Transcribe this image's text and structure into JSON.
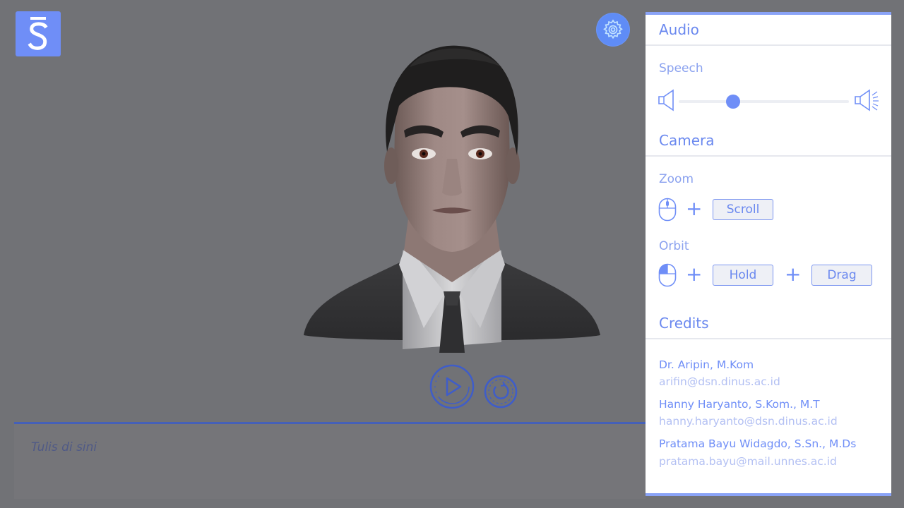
{
  "app": {
    "logo_letter": "S",
    "brand_color": "#6f8ef7",
    "accent_dark": "#4560b8"
  },
  "controls": {
    "settings_icon": "gear-icon",
    "play_icon": "play-icon",
    "reset_icon": "reset-icon"
  },
  "chat_input": {
    "placeholder": "Tulis di sini",
    "value": ""
  },
  "panel": {
    "audio": {
      "title": "Audio",
      "speech_label": "Speech",
      "speech_volume": 0.32
    },
    "camera": {
      "title": "Camera",
      "zoom_label": "Zoom",
      "zoom_key": "Scroll",
      "orbit_label": "Orbit",
      "orbit_hold_key": "Hold",
      "orbit_drag_key": "Drag",
      "plus": "+"
    },
    "credits": {
      "title": "Credits",
      "people": [
        {
          "name": "Dr. Aripin, M.Kom",
          "email": "arifin@dsn.dinus.ac.id"
        },
        {
          "name": "Hanny Haryanto, S.Kom., M.T",
          "email": "hanny.haryanto@dsn.dinus.ac.id"
        },
        {
          "name": "Pratama Bayu Widagdo, S.Sn., M.Ds",
          "email": "pratama.bayu@mail.unnes.ac.id"
        }
      ]
    }
  }
}
